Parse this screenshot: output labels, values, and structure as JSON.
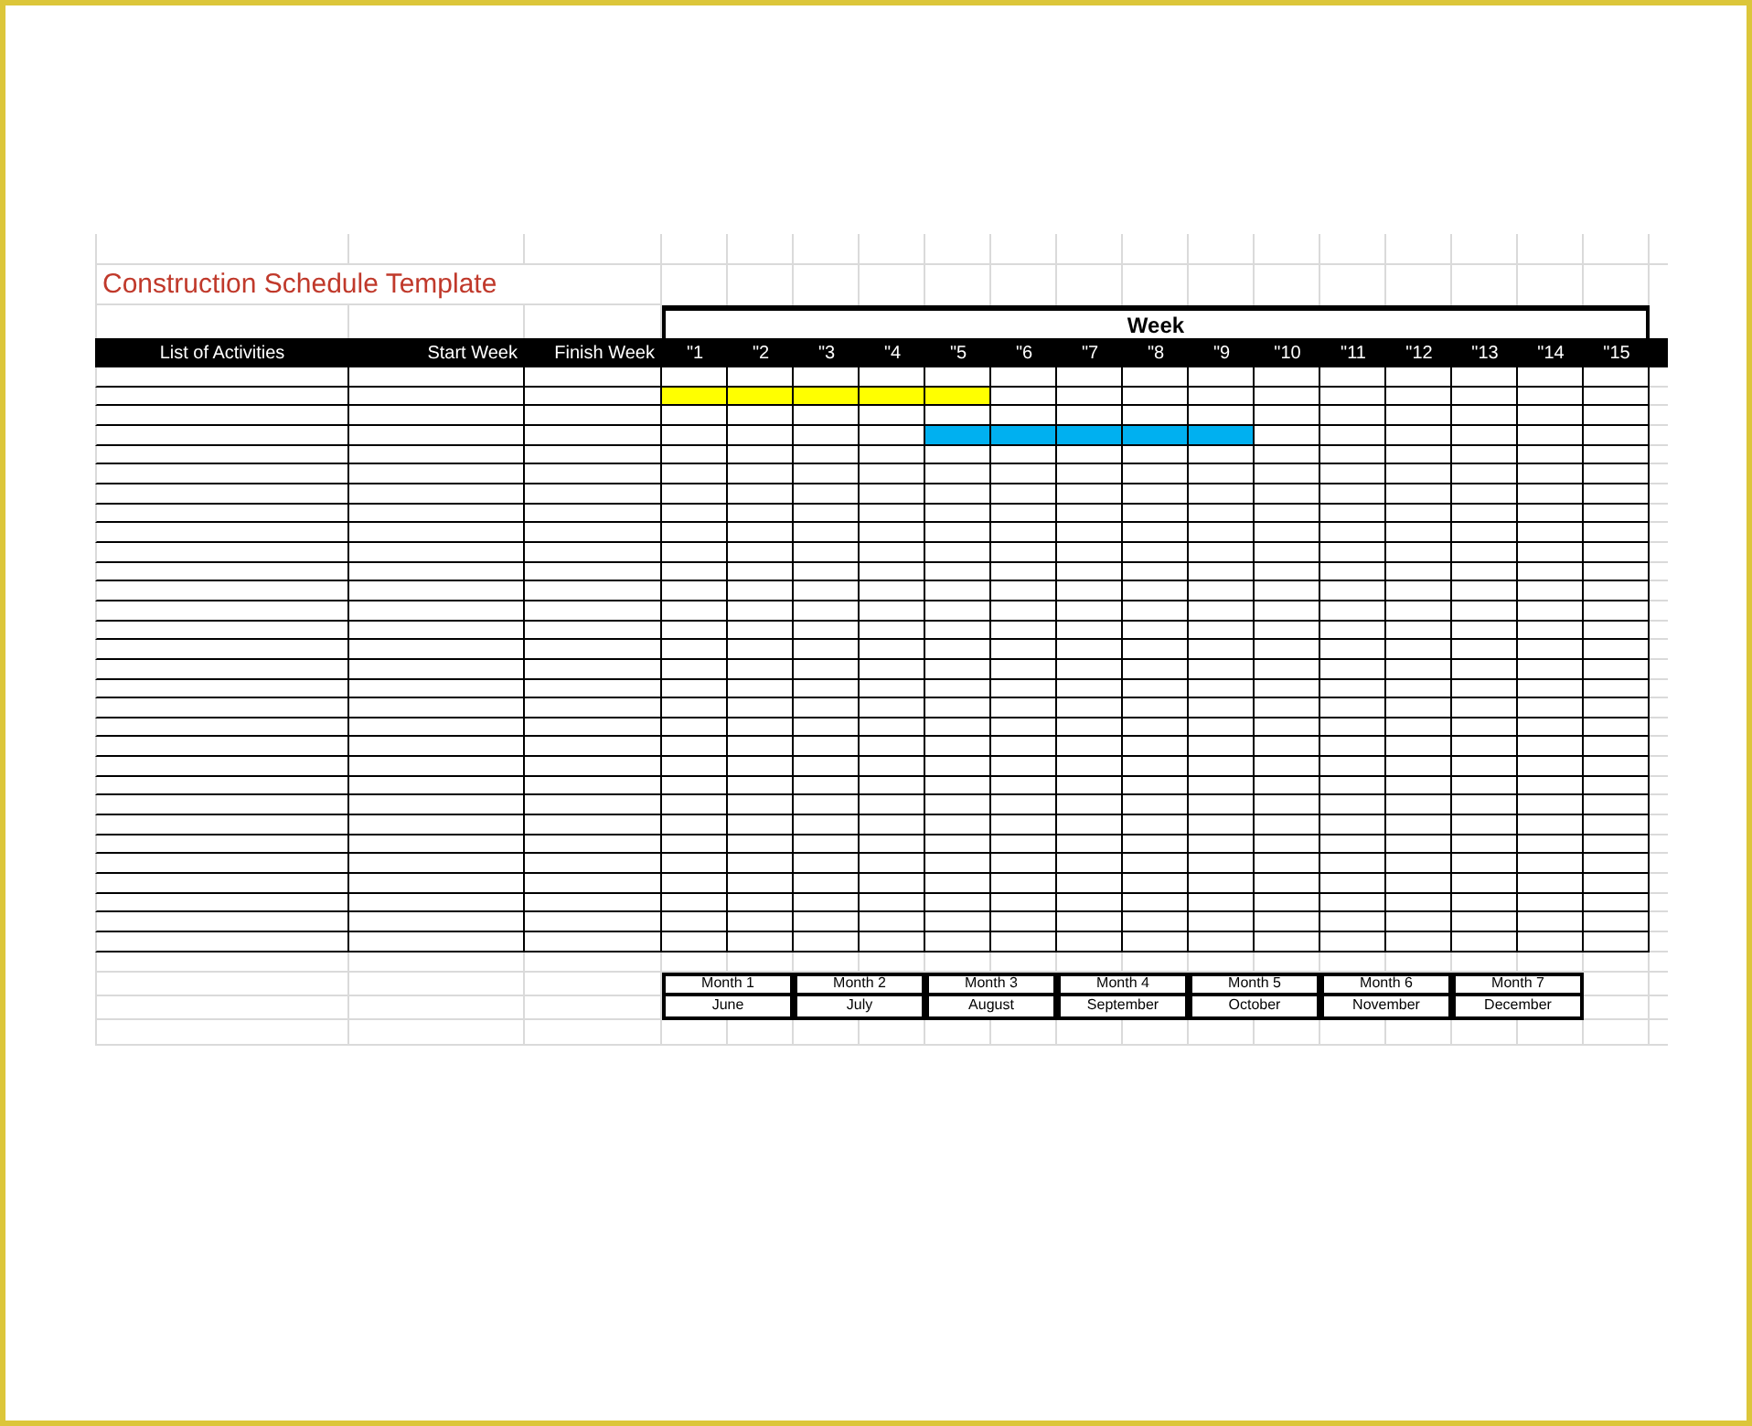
{
  "title": "Construction Schedule Template",
  "week_header": "Week",
  "columns": [
    "List of Activities",
    "Start Week",
    "Finish Week"
  ],
  "weeks": [
    "\"1",
    "\"2",
    "\"3",
    "\"4",
    "\"5",
    "\"6",
    "\"7",
    "\"8",
    "\"9",
    "\"10",
    "\"11",
    "\"12",
    "\"13",
    "\"14",
    "\"15"
  ],
  "rows": [
    {},
    {
      "bar": {
        "color": "#ffff00",
        "filled": [
          true,
          true,
          true,
          true,
          true,
          false,
          false,
          false,
          false,
          false,
          false,
          false,
          false,
          false,
          false
        ]
      }
    },
    {},
    {
      "bar": {
        "color": "#00b0f0",
        "filled": [
          false,
          false,
          false,
          false,
          true,
          true,
          true,
          true,
          true,
          false,
          false,
          false,
          false,
          false,
          false
        ]
      }
    },
    {},
    {},
    {},
    {},
    {},
    {},
    {},
    {},
    {},
    {},
    {},
    {},
    {},
    {},
    {},
    {},
    {},
    {},
    {},
    {},
    {},
    {},
    {},
    {},
    {},
    {}
  ],
  "months": [
    {
      "label": "Month 1",
      "name": "June"
    },
    {
      "label": "Month 2",
      "name": "July"
    },
    {
      "label": "Month 3",
      "name": "August"
    },
    {
      "label": "Month 4",
      "name": "September"
    },
    {
      "label": "Month 5",
      "name": "October"
    },
    {
      "label": "Month 6",
      "name": "November"
    },
    {
      "label": "Month 7",
      "name": "December"
    }
  ]
}
